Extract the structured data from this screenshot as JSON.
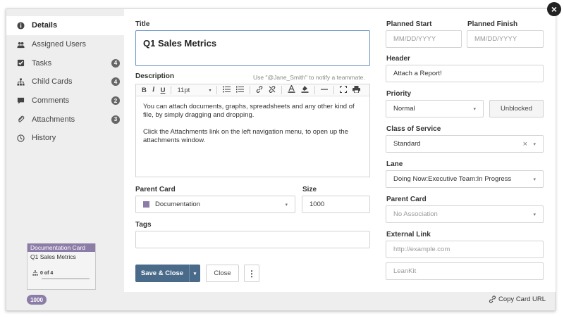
{
  "sidebar": {
    "items": [
      {
        "label": "Details",
        "icon": "info-icon",
        "count": ""
      },
      {
        "label": "Assigned Users",
        "icon": "users-icon",
        "count": ""
      },
      {
        "label": "Tasks",
        "icon": "checkbox-icon",
        "count": "4"
      },
      {
        "label": "Child Cards",
        "icon": "hierarchy-icon",
        "count": "4"
      },
      {
        "label": "Comments",
        "icon": "comment-icon",
        "count": "2"
      },
      {
        "label": "Attachments",
        "icon": "paperclip-icon",
        "count": "3"
      },
      {
        "label": "History",
        "icon": "clock-icon",
        "count": ""
      }
    ],
    "card_preview": {
      "type": "Documentation Card",
      "title": "Q1 Sales Metrics",
      "progress_text": "0 of 4",
      "progress": 0.0,
      "id": "1000",
      "color": "#8c7ca8"
    }
  },
  "form": {
    "title_label": "Title",
    "title_value": "Q1 Sales Metrics",
    "description_label": "Description",
    "description_hint": "Use \"@Jane_Smith\" to notify a teammate.",
    "toolbar": {
      "bold": "B",
      "italic": "I",
      "underline": "U",
      "font_size": "11pt"
    },
    "description_p1": "You can attach documents, graphs, spreadsheets and any other kind of file, by simply dragging and dropping.",
    "description_p2": "Click the Attachments link on the left navigation menu, to open up the attachments window.",
    "parent_card_label": "Parent Card",
    "parent_card_value": "Documentation",
    "size_label": "Size",
    "size_value": "1000",
    "tags_label": "Tags",
    "tags_value": "",
    "save_label": "Save & Close",
    "close_label": "Close",
    "more_label": "⋮"
  },
  "right": {
    "planned_start_label": "Planned Start",
    "planned_start_placeholder": "MM/DD/YYYY",
    "planned_finish_label": "Planned Finish",
    "planned_finish_placeholder": "MM/DD/YYYY",
    "header_label": "Header",
    "header_value": "Attach a Report!",
    "priority_label": "Priority",
    "priority_value": "Normal",
    "unblocked_label": "Unblocked",
    "class_label": "Class of Service",
    "class_value": "Standard",
    "lane_label": "Lane",
    "lane_value": "Doing Now:Executive Team:In Progress",
    "parent_card_label": "Parent Card",
    "parent_card_placeholder": "No Association",
    "external_link_label": "External Link",
    "external_link_placeholder": "http://example.com",
    "external_link_title_placeholder": "LeanKit"
  },
  "footer": {
    "copy_url_label": "Copy Card URL"
  },
  "colors": {
    "accent": "#4a6a8a",
    "card_type": "#8c7ca8",
    "focus_border": "#6b93c7"
  }
}
